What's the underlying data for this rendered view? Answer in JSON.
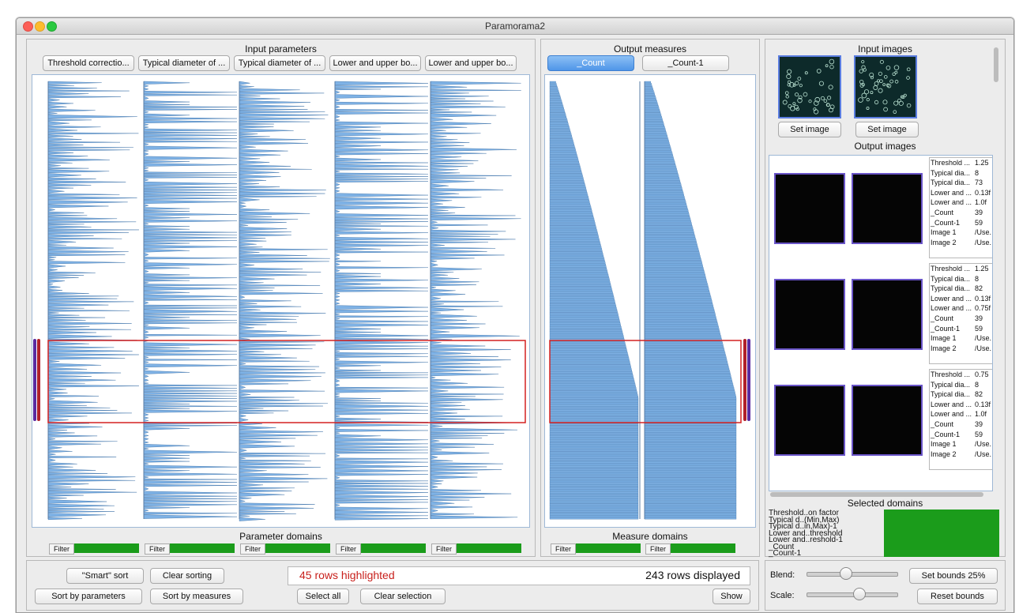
{
  "window": {
    "title": "Paramorama2"
  },
  "input_panel": {
    "title": "Input parameters",
    "params": [
      "Threshold correctio...",
      "Typical diameter of ...",
      "Typical diameter of ...",
      "Lower and upper bo...",
      "Lower and upper bo..."
    ],
    "domains_title": "Parameter domains",
    "filter_label": "Filter"
  },
  "output_panel": {
    "title": "Output measures",
    "measures": [
      "_Count",
      "_Count-1"
    ],
    "domains_title": "Measure domains",
    "filter_label": "Filter"
  },
  "images_panel": {
    "input_title": "Input images",
    "set_image_label": "Set image",
    "output_title": "Output images",
    "records": [
      {
        "rows": [
          [
            "Threshold ...",
            "1.25"
          ],
          [
            "Typical dia...",
            "8"
          ],
          [
            "Typical dia...",
            "73"
          ],
          [
            "Lower and ...",
            "0.13f"
          ],
          [
            "Lower and ...",
            "1.0f"
          ],
          [
            "_Count",
            "39"
          ],
          [
            "_Count-1",
            "59"
          ],
          [
            "Image 1",
            "/Use."
          ],
          [
            "Image 2",
            "/Use."
          ]
        ]
      },
      {
        "rows": [
          [
            "Threshold ...",
            "1.25"
          ],
          [
            "Typical dia...",
            "8"
          ],
          [
            "Typical dia...",
            "82"
          ],
          [
            "Lower and ...",
            "0.13f"
          ],
          [
            "Lower and ...",
            "0.75f"
          ],
          [
            "_Count",
            "39"
          ],
          [
            "_Count-1",
            "59"
          ],
          [
            "Image 1",
            "/Use."
          ],
          [
            "Image 2",
            "/Use."
          ]
        ]
      },
      {
        "rows": [
          [
            "Threshold ...",
            "0.75"
          ],
          [
            "Typical dia...",
            "8"
          ],
          [
            "Typical dia...",
            "82"
          ],
          [
            "Lower and ...",
            "0.13f"
          ],
          [
            "Lower and ...",
            "1.0f"
          ],
          [
            "_Count",
            "39"
          ],
          [
            "_Count-1",
            "59"
          ],
          [
            "Image 1",
            "/Use."
          ],
          [
            "Image 2",
            "/Use."
          ]
        ]
      }
    ]
  },
  "selected_domains": {
    "title": "Selected domains",
    "rows": [
      "Threshold..on factor",
      "Typical d..(Min,Max)",
      "Typical d..in,Max)-1",
      "Lower and..threshold",
      "Lower and..reshold-1",
      "_Count",
      "_Count-1"
    ]
  },
  "bottom": {
    "smart_sort": "\"Smart\" sort",
    "clear_sorting": "Clear sorting",
    "sort_params": "Sort by parameters",
    "sort_measures": "Sort by measures",
    "highlighted": "45 rows highlighted",
    "displayed": "243 rows displayed",
    "select_all": "Select all",
    "clear_selection": "Clear selection",
    "show": "Show",
    "blend_label": "Blend:",
    "scale_label": "Scale:",
    "set_bounds": "Set bounds 25%",
    "reset_bounds": "Reset bounds",
    "blend_value": 0.25,
    "scale_value": 0.4
  },
  "colors": {
    "bar_fill": "#7fb2e5",
    "bar_stroke": "#3b6ea5",
    "highlight": "#d42020",
    "filter_green": "#1a9c1a",
    "accent_red": "#c8201c"
  }
}
